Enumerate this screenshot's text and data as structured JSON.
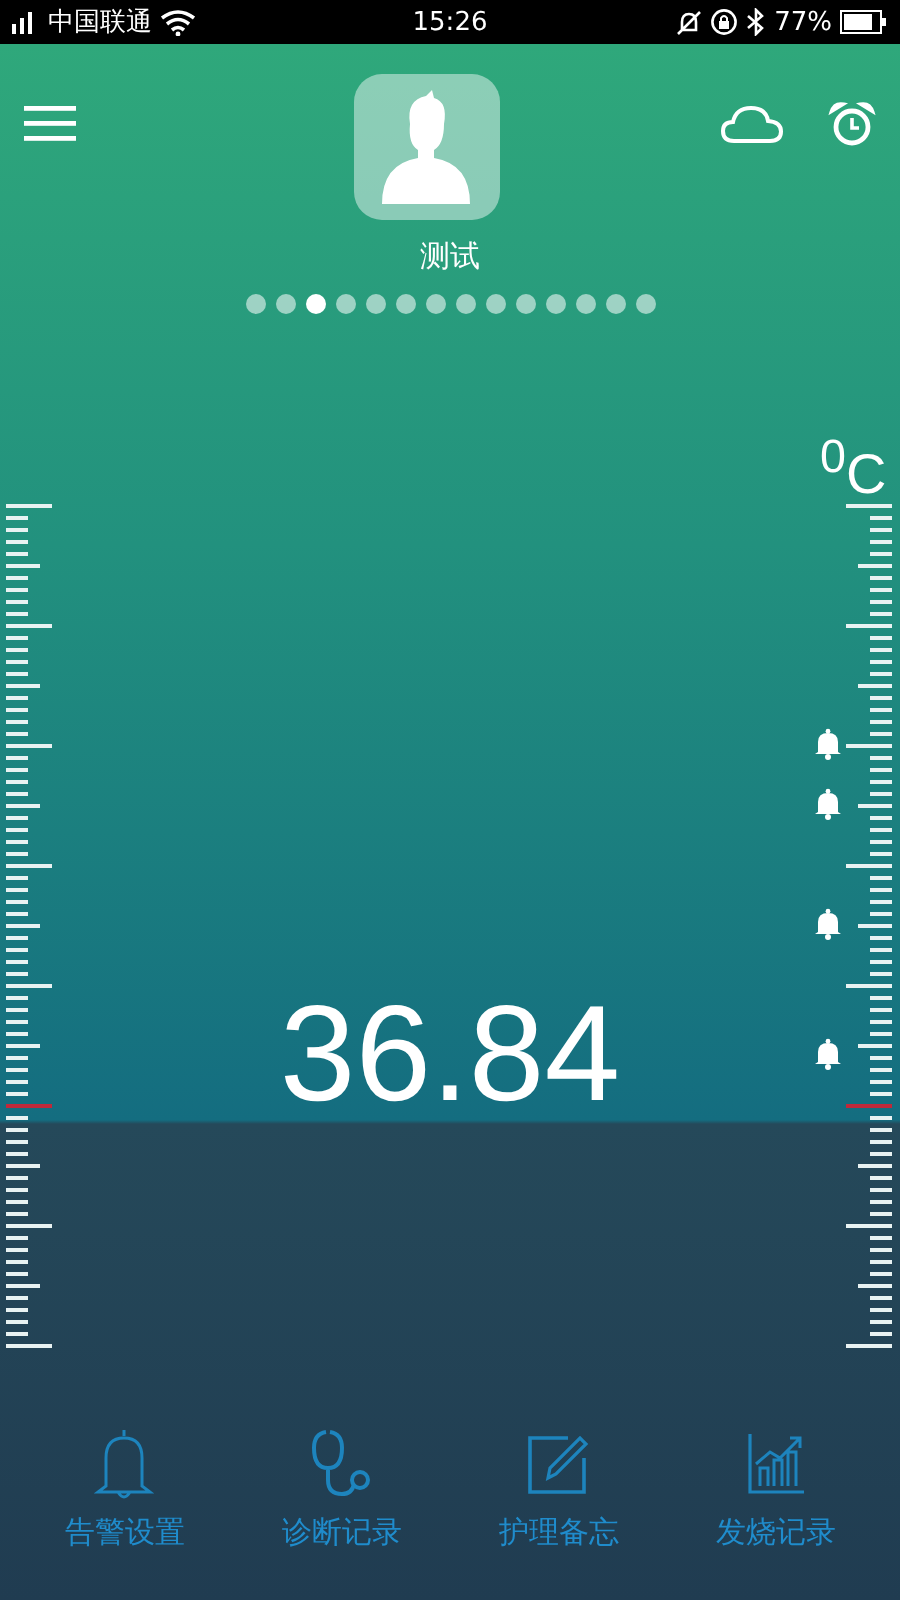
{
  "status_bar": {
    "carrier": "中国联通",
    "time": "15:26",
    "battery": "77%"
  },
  "profile": {
    "name": "测试"
  },
  "pages": [
    {
      "selected": false
    },
    {
      "selected": false
    },
    {
      "selected": true
    },
    {
      "selected": false
    },
    {
      "selected": false
    },
    {
      "selected": false
    },
    {
      "selected": false
    },
    {
      "selected": false
    },
    {
      "selected": false
    },
    {
      "selected": false
    },
    {
      "selected": false
    },
    {
      "selected": false
    },
    {
      "selected": false
    },
    {
      "selected": false
    }
  ],
  "thermometer": {
    "unit": "$^{0}$C",
    "reading": "36.84"
  },
  "nav": [
    {
      "kind": "bell",
      "label": "告警设置"
    },
    {
      "kind": "stethoscope",
      "label": "诊断记录"
    },
    {
      "kind": "note",
      "label": "护理备忘"
    },
    {
      "kind": "chart",
      "label": "发烧记录"
    }
  ]
}
